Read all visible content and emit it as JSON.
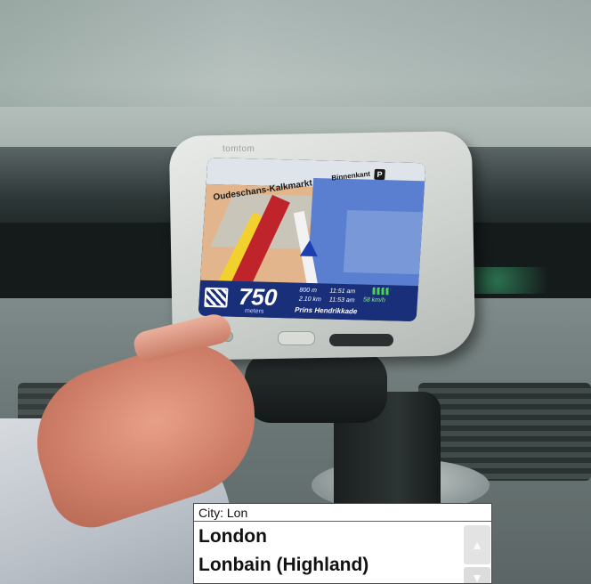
{
  "gps": {
    "brand": "tomtom",
    "map": {
      "street_top_left": "Oudeschans-Kalkmarkt",
      "street_top_right": "Binnenkant",
      "parking_glyph": "P"
    },
    "status": {
      "distance_value": "750",
      "distance_unit": "meters",
      "col1_line1": "800 m",
      "col1_line2": "2.10 km",
      "col2_line1": "11:51 am",
      "col2_line2": "11:53 am",
      "speed": "58 km/h",
      "street": "Prins Hendrikkade"
    }
  },
  "city_search": {
    "header": "City: Lon",
    "results": [
      {
        "label": "London"
      },
      {
        "label": "Lonbain (Highland)"
      }
    ],
    "scroll_up_glyph": "▲",
    "scroll_down_glyph": "▼"
  }
}
